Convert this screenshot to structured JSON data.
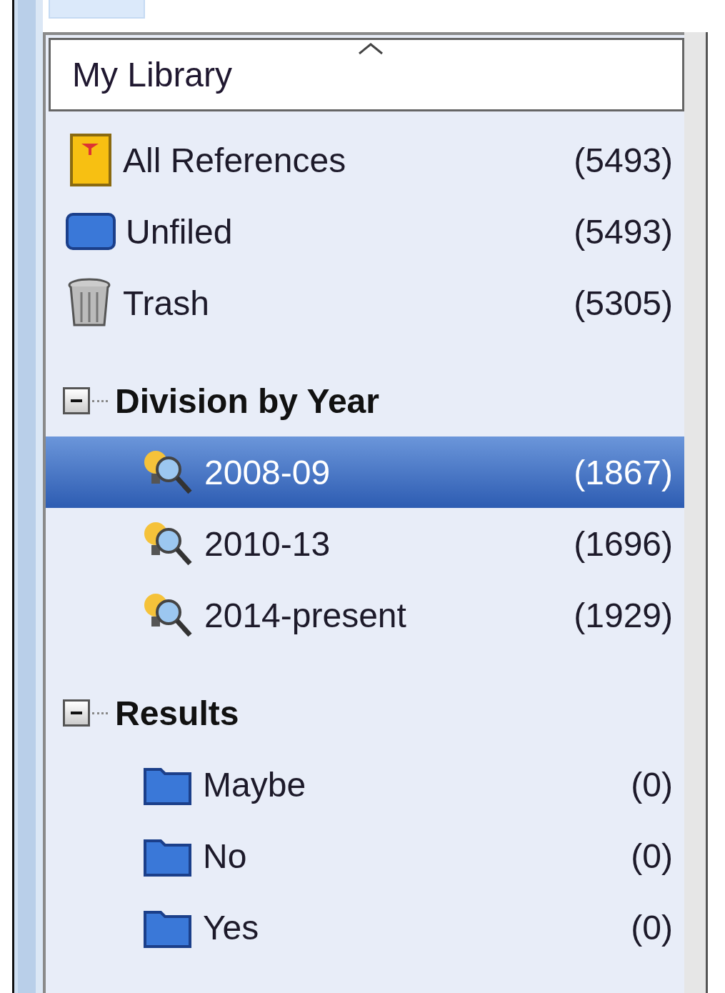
{
  "header": {
    "title": "My Library"
  },
  "items": [
    {
      "kind": "all",
      "label": "All References",
      "count": "(5493)",
      "selected": false
    },
    {
      "kind": "unfiled",
      "label": "Unfiled",
      "count": "(5493)",
      "selected": false
    },
    {
      "kind": "trash",
      "label": "Trash",
      "count": "(5305)",
      "selected": false
    }
  ],
  "groups": [
    {
      "title": "Division by Year",
      "expanded": true,
      "children": [
        {
          "kind": "smart",
          "label": "2008-09",
          "count": "(1867)",
          "selected": true
        },
        {
          "kind": "smart",
          "label": "2010-13",
          "count": "(1696)",
          "selected": false
        },
        {
          "kind": "smart",
          "label": "2014-present",
          "count": "(1929)",
          "selected": false
        }
      ]
    },
    {
      "title": "Results",
      "expanded": true,
      "children": [
        {
          "kind": "folder",
          "label": "Maybe",
          "count": "(0)",
          "selected": false
        },
        {
          "kind": "folder",
          "label": "No",
          "count": "(0)",
          "selected": false
        },
        {
          "kind": "folder",
          "label": "Yes",
          "count": "(0)",
          "selected": false
        }
      ]
    }
  ]
}
